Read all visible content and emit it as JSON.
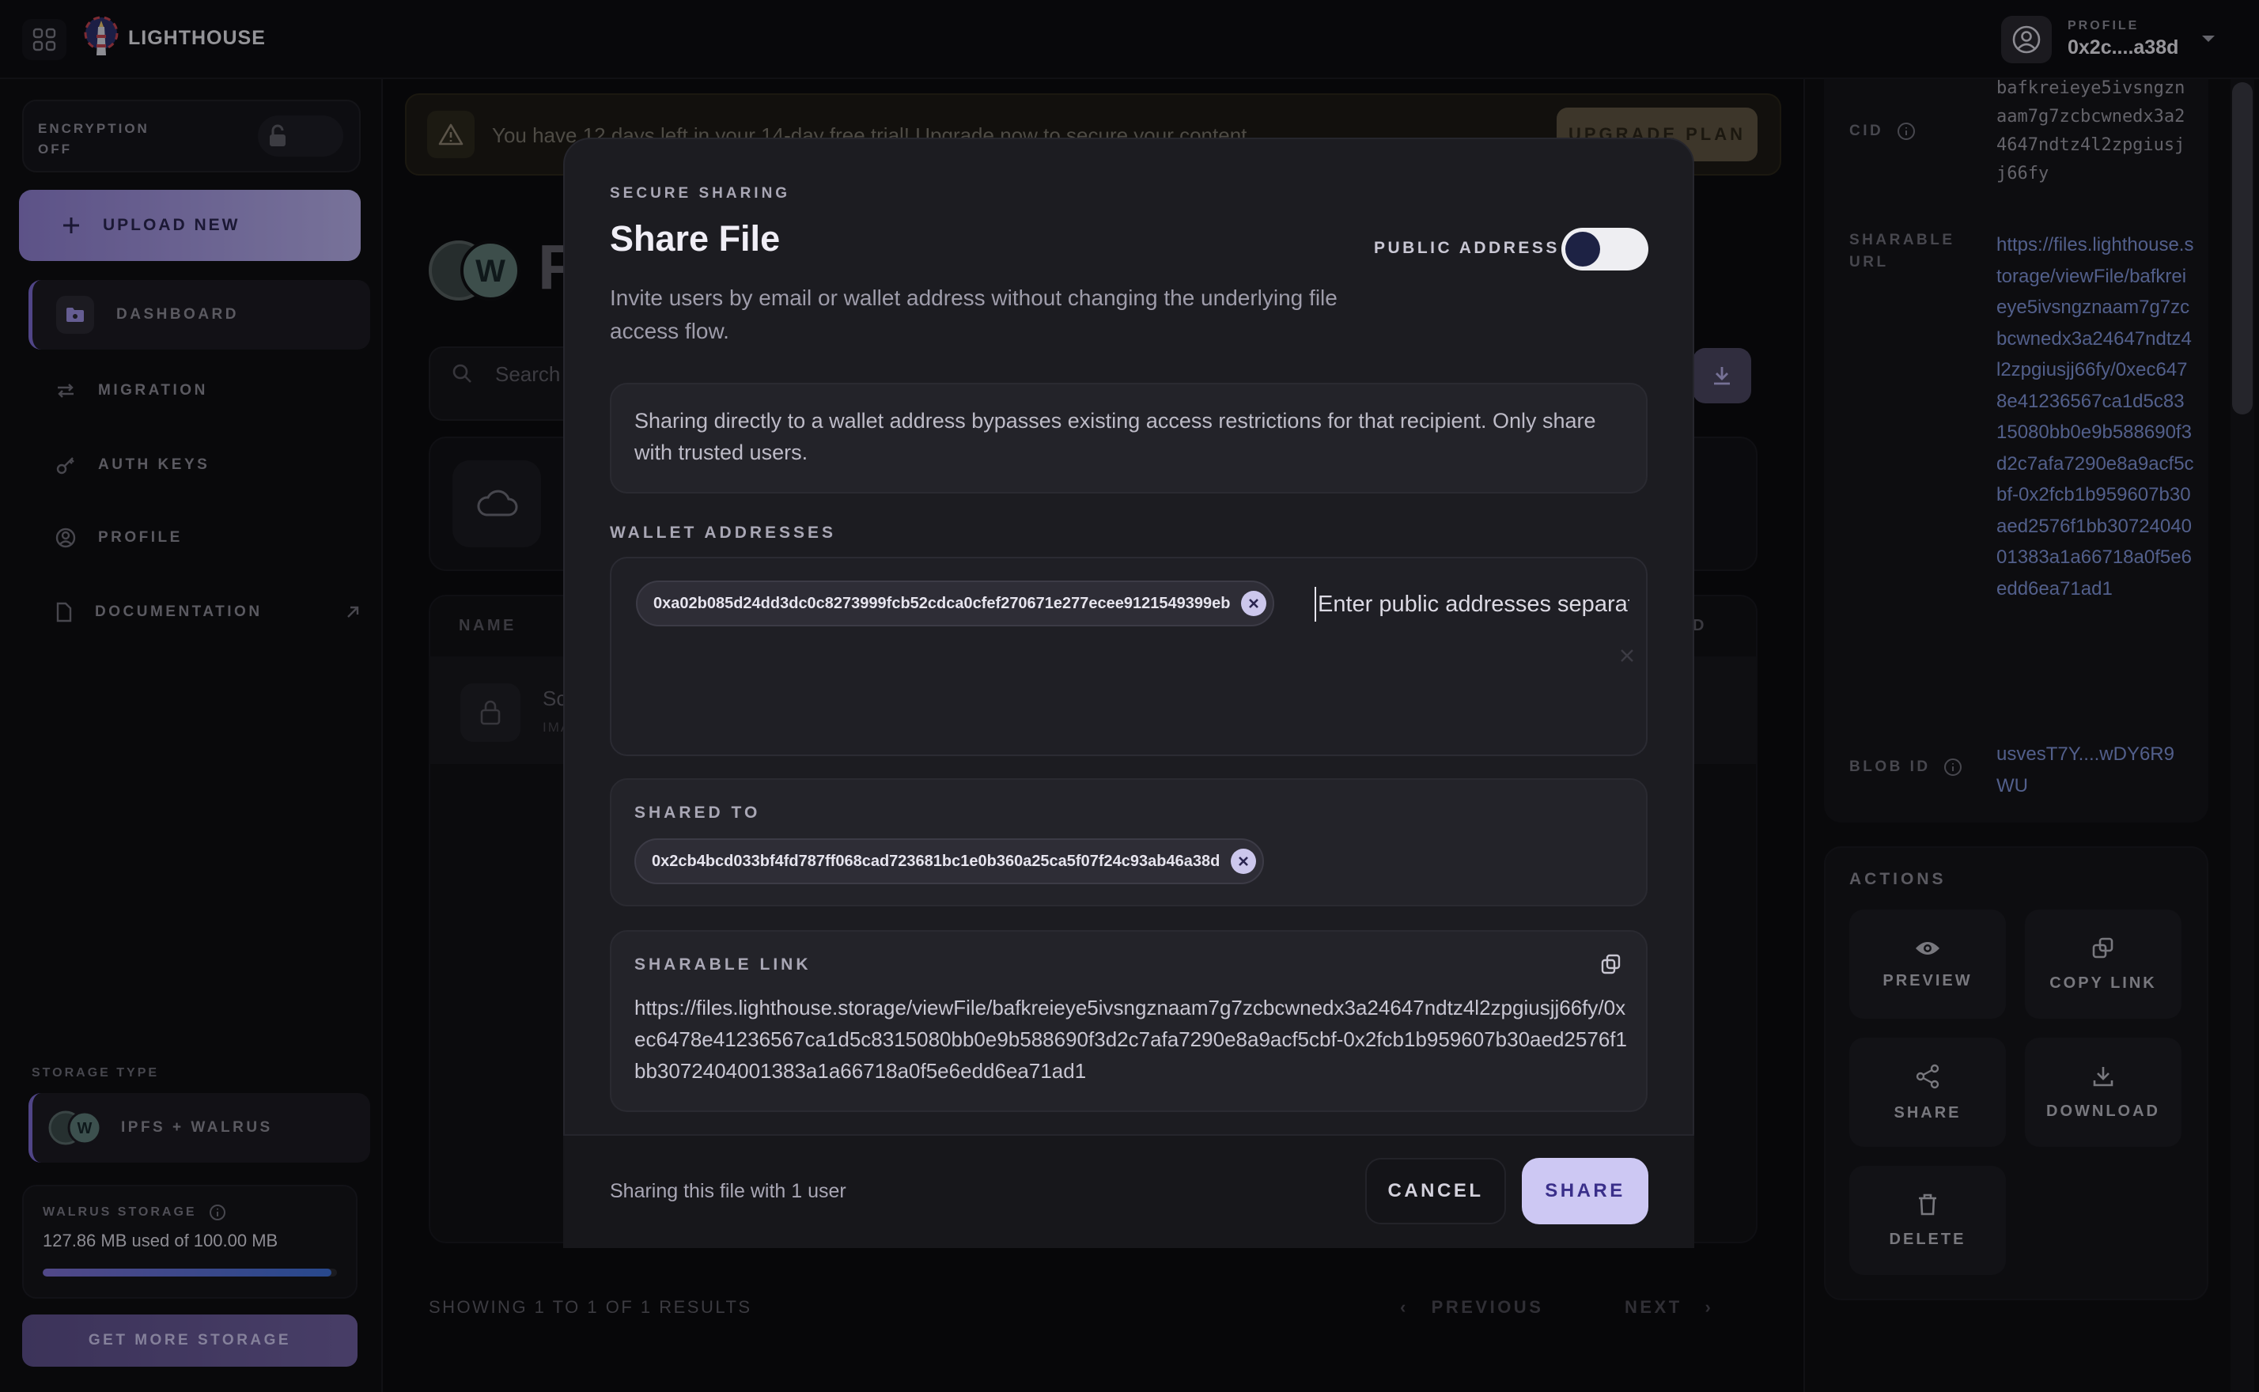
{
  "app": {
    "brand": "LIGHTHOUSE"
  },
  "profile": {
    "label": "PROFILE",
    "address": "0x2c....a38d"
  },
  "sidebar": {
    "encryption_label": "ENCRYPTION",
    "encryption_state": "OFF",
    "upload_label": "UPLOAD NEW",
    "items": [
      {
        "label": "DASHBOARD",
        "icon": "folder-icon",
        "active": true
      },
      {
        "label": "MIGRATION",
        "icon": "swap-icon",
        "active": false
      },
      {
        "label": "AUTH KEYS",
        "icon": "key-icon",
        "active": false
      },
      {
        "label": "PROFILE",
        "icon": "user-icon",
        "active": false
      },
      {
        "label": "DOCUMENTATION",
        "icon": "document-icon",
        "active": false
      }
    ],
    "storage_type_label": "STORAGE TYPE",
    "storage_type_value": "IPFS + WALRUS",
    "walrus_label": "WALRUS STORAGE",
    "walrus_used": "127.86 MB used of 100.00 MB",
    "walrus_fill_fraction": 0.98,
    "more_storage_label": "GET MORE STORAGE"
  },
  "main": {
    "trial_text": "You have 12 days left in your 14-day free trial! Upgrade now to secure your content.",
    "upgrade_label": "UPGRADE PLAN",
    "title_fragment": "F",
    "search_placeholder": "Search",
    "table_header_name": "NAME",
    "table_header_right": "D",
    "row_name": "Sc",
    "row_sub": "IMA",
    "showing": "SHOWING 1 TO 1 OF 1 RESULTS",
    "prev_label": "PREVIOUS",
    "next_label": "NEXT"
  },
  "details": {
    "cid_label": "CID",
    "cid_value": "bafkreieye5ivsngznaam7g7zcbcwnedx3a24647ndtz4l2zpgiusjj66fy",
    "url_label": "SHARABLE URL",
    "url_value": "https://files.lighthouse.storage/viewFile/bafkreieye5ivsngznaam7g7zcbcwnedx3a24647ndtz4l2zpgiusjj66fy/0xec6478e41236567ca1d5c8315080bb0e9b588690f3d2c7afa7290e8a9acf5cbf-0x2fcb1b959607b30aed2576f1bb3072404001383a1a66718a0f5e6edd6ea71ad1",
    "blob_label": "BLOB ID",
    "blob_value": "usvesT7Y....wDY6R9WU"
  },
  "actions": {
    "label": "ACTIONS",
    "items": [
      {
        "label": "PREVIEW",
        "icon": "eye-icon"
      },
      {
        "label": "COPY LINK",
        "icon": "copy-icon"
      },
      {
        "label": "SHARE",
        "icon": "share-icon"
      },
      {
        "label": "DOWNLOAD",
        "icon": "download-icon"
      },
      {
        "label": "DELETE",
        "icon": "trash-icon"
      }
    ]
  },
  "modal": {
    "eyebrow": "SECURE SHARING",
    "title": "Share File",
    "description": "Invite users by email or wallet address without changing the underlying file access flow.",
    "public_address_label": "PUBLIC ADDRESS",
    "public_address_on": true,
    "warning": "Sharing directly to a wallet address bypasses existing access restrictions for that recipient. Only share with trusted users.",
    "wallet_label": "WALLET ADDRESSES",
    "wallet_chip": "0xa02b085d24dd3dc0c8273999fcb52cdca0cfef270671e277ecee9121549399eb",
    "wallet_placeholder": "Enter public addresses separated by commas",
    "shared_to_label": "SHARED TO",
    "shared_to_chip": "0x2cb4bcd033bf4fd787ff068cad723681bc1e0b360a25ca5f07f24c93ab46a38d",
    "sharable_link_label": "SHARABLE LINK",
    "sharable_link": "https://files.lighthouse.storage/viewFile/bafkreieye5ivsngznaam7g7zcbcwnedx3a24647ndtz4l2zpgiusjj66fy/0xec6478e41236567ca1d5c8315080bb0e9b588690f3d2c7afa7290e8a9acf5cbf-0x2fcb1b959607b30aed2576f1bb3072404001383a1a66718a0f5e6edd6ea71ad1",
    "footer_note": "Sharing this file with 1 user",
    "cancel_label": "CANCEL",
    "share_label": "SHARE"
  }
}
